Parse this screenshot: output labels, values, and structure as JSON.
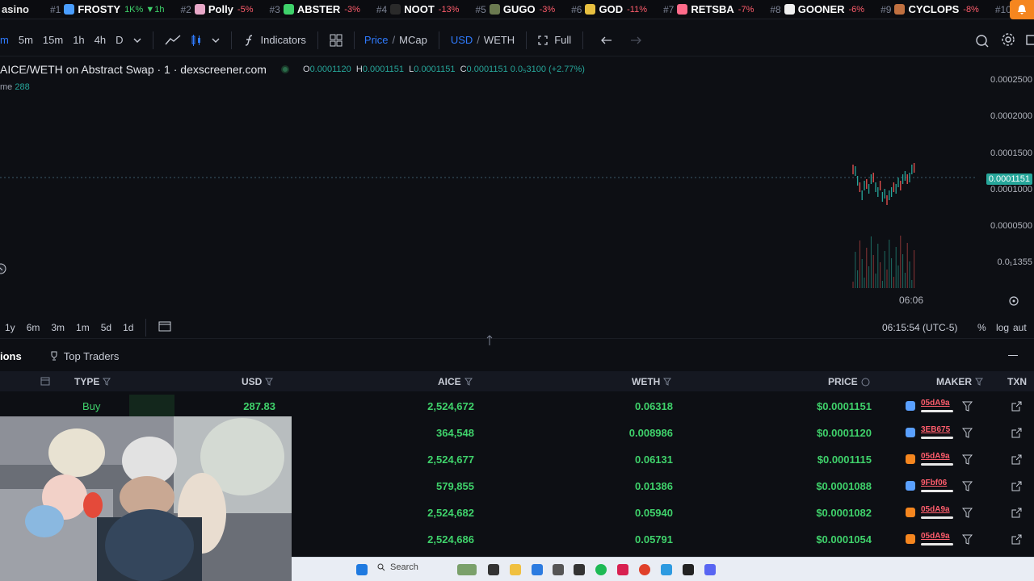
{
  "ticker": {
    "lead": "asino",
    "items": [
      {
        "rank": "#1",
        "symbol": "FROSTY",
        "change": "1K% ▼1h",
        "color": "#4a9eff",
        "dir": "green"
      },
      {
        "rank": "#2",
        "symbol": "Polly",
        "change": "-5%",
        "color": "#e8a8c8",
        "dir": "down"
      },
      {
        "rank": "#3",
        "symbol": "ABSTER",
        "change": "-3%",
        "color": "#3fd26b",
        "dir": "down"
      },
      {
        "rank": "#4",
        "symbol": "NOOT",
        "change": "-13%",
        "color": "#2a2a2a",
        "dir": "down"
      },
      {
        "rank": "#5",
        "symbol": "GUGO",
        "change": "-3%",
        "color": "#6b7a50",
        "dir": "down"
      },
      {
        "rank": "#6",
        "symbol": "GOD",
        "change": "-11%",
        "color": "#e8c040",
        "dir": "down"
      },
      {
        "rank": "#7",
        "symbol": "RETSBA",
        "change": "-7%",
        "color": "#ff6b8a",
        "dir": "down"
      },
      {
        "rank": "#8",
        "symbol": "GOONER",
        "change": "-6%",
        "color": "#f0f0f0",
        "dir": "down"
      },
      {
        "rank": "#9",
        "symbol": "CYCLOPS",
        "change": "-8%",
        "color": "#c07040",
        "dir": "down"
      },
      {
        "rank": "#10",
        "symbol": "",
        "change": "",
        "color": "#333",
        "dir": "down"
      }
    ]
  },
  "toolbar": {
    "intervals": [
      "m",
      "5m",
      "15m",
      "1h",
      "4h",
      "D"
    ],
    "indicators": "Indicators",
    "price": "Price",
    "mcap": "MCap",
    "usd": "USD",
    "weth": "WETH",
    "full": "Full"
  },
  "chart": {
    "title": "AICE/WETH on Abstract Swap · 1 · dexscreener.com",
    "ohlc": {
      "o_label": "O",
      "o": "0.0001120",
      "h_label": "H",
      "h": "0.0001151",
      "l_label": "L",
      "l": "0.0001151",
      "c_label": "C",
      "c": "0.0001151",
      "change": "0.0₅3100 (+2.77%)"
    },
    "volume_label": "me",
    "volume_value": "288",
    "y_ticks": [
      "0.0002500",
      "0.0002000",
      "0.0001500",
      "0.0001000",
      "0.0000500",
      "0.0₁1355"
    ],
    "current_price": "0.0001151",
    "x_time": "06:06"
  },
  "rangebar": {
    "ranges": [
      "1y",
      "6m",
      "3m",
      "1m",
      "5d",
      "1d"
    ],
    "clock": "06:15:54 (UTC-5)",
    "percent": "%",
    "log": "log",
    "auto": "aut"
  },
  "tabs": {
    "transactions": "ions",
    "top_traders": "Top Traders"
  },
  "table": {
    "headers": {
      "type": "TYPE",
      "usd": "USD",
      "aice": "AICE",
      "weth": "WETH",
      "price": "PRICE",
      "maker": "MAKER",
      "txn": "TXN"
    },
    "rows": [
      {
        "type": "Buy",
        "usd": "287.83",
        "aice": "2,524,672",
        "weth": "0.06318",
        "price": "$0.0001151",
        "maker": "05dA9a",
        "maker_color": "#5aa0ff"
      },
      {
        "type": "",
        "usd": "",
        "aice": "364,548",
        "weth": "0.008986",
        "price": "$0.0001120",
        "maker": "3EB675",
        "maker_color": "#5aa0ff"
      },
      {
        "type": "",
        "usd": "",
        "aice": "2,524,677",
        "weth": "0.06131",
        "price": "$0.0001115",
        "maker": "05dA9a",
        "maker_color": "#f5861f"
      },
      {
        "type": "",
        "usd": "",
        "aice": "579,855",
        "weth": "0.01386",
        "price": "$0.0001088",
        "maker": "9Fbf06",
        "maker_color": "#5aa0ff"
      },
      {
        "type": "",
        "usd": "",
        "aice": "2,524,682",
        "weth": "0.05940",
        "price": "$0.0001082",
        "maker": "05dA9a",
        "maker_color": "#f5861f"
      },
      {
        "type": "",
        "usd": "",
        "aice": "2,524,686",
        "weth": "0.05791",
        "price": "$0.0001054",
        "maker": "05dA9a",
        "maker_color": "#f5861f"
      }
    ]
  },
  "taskbar": {
    "search": "Search"
  }
}
